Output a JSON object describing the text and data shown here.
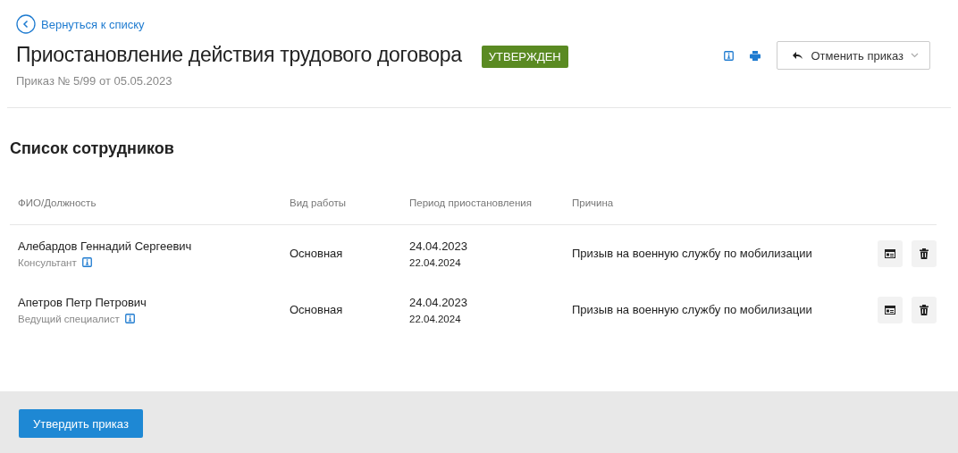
{
  "back_link": "Вернуться к списку",
  "title": "Приостановление действия трудового договора",
  "status": {
    "label": "УТВЕРЖДЕН",
    "color": "#5a8a22"
  },
  "subtitle": "Приказ № 5/99 от 05.05.2023",
  "cancel_button": "Отменить приказ",
  "section_title": "Список сотрудников",
  "table": {
    "columns": [
      "ФИО/Должность",
      "Вид работы",
      "Период приостановления",
      "Причина"
    ],
    "rows": [
      {
        "name": "Алебардов Геннадий Сергеевич",
        "position": "Консультант",
        "work_type": "Основная",
        "start": "24.04.2023",
        "end": "22.04.2024",
        "reason": "Призыв на военную службу по мобилизации"
      },
      {
        "name": "Апетров Петр Петрович",
        "position": "Ведущий специалист",
        "work_type": "Основная",
        "start": "24.04.2023",
        "end": "22.04.2024",
        "reason": "Призыв на военную службу по мобилизации"
      }
    ]
  },
  "approve_button": "Утвердить приказ"
}
